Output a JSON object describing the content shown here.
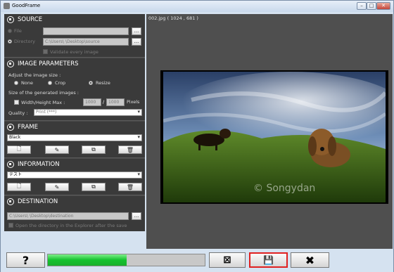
{
  "window": {
    "title": "GoodFrame",
    "min": "–",
    "max": "□",
    "close": "✕"
  },
  "source": {
    "title": "SOURCE",
    "file_label": "File",
    "directory_label": "Directory",
    "file_value": "",
    "directory_value": "C:\\Users\\        \\Desktop\\source",
    "browse": "...",
    "validate_label": "Validate every image"
  },
  "image_params": {
    "title": "IMAGE PARAMETERS",
    "adjust_label": "Adjust the image size :",
    "options": [
      "None",
      "Crop",
      "Resize"
    ],
    "size_label": "Size of the generated images :",
    "wh_label": "Width/Height Max :",
    "width": "1000",
    "sep": "/",
    "height": "1000",
    "unit": "Pixels",
    "quality_label": "Quality :",
    "quality_value": "Print (***)"
  },
  "frame": {
    "title": "FRAME",
    "value": "Black"
  },
  "information": {
    "title": "INFORMATION",
    "value": "テスト"
  },
  "destination": {
    "title": "DESTINATION",
    "value": "C:\\Users\\        \\Desktop\\destination",
    "browse": "...",
    "open_label": "Open the directory in the Explorer after the save"
  },
  "preview": {
    "caption": "002.jpg ( 1024 , 681 )",
    "watermark": "© Songydan"
  },
  "bottom": {
    "help": "?",
    "progress": 0.5,
    "save": "💾",
    "cancel": "✖",
    "clear": "⊠"
  },
  "colors": {
    "accent": "#e02020",
    "progress": "#14c22e"
  }
}
